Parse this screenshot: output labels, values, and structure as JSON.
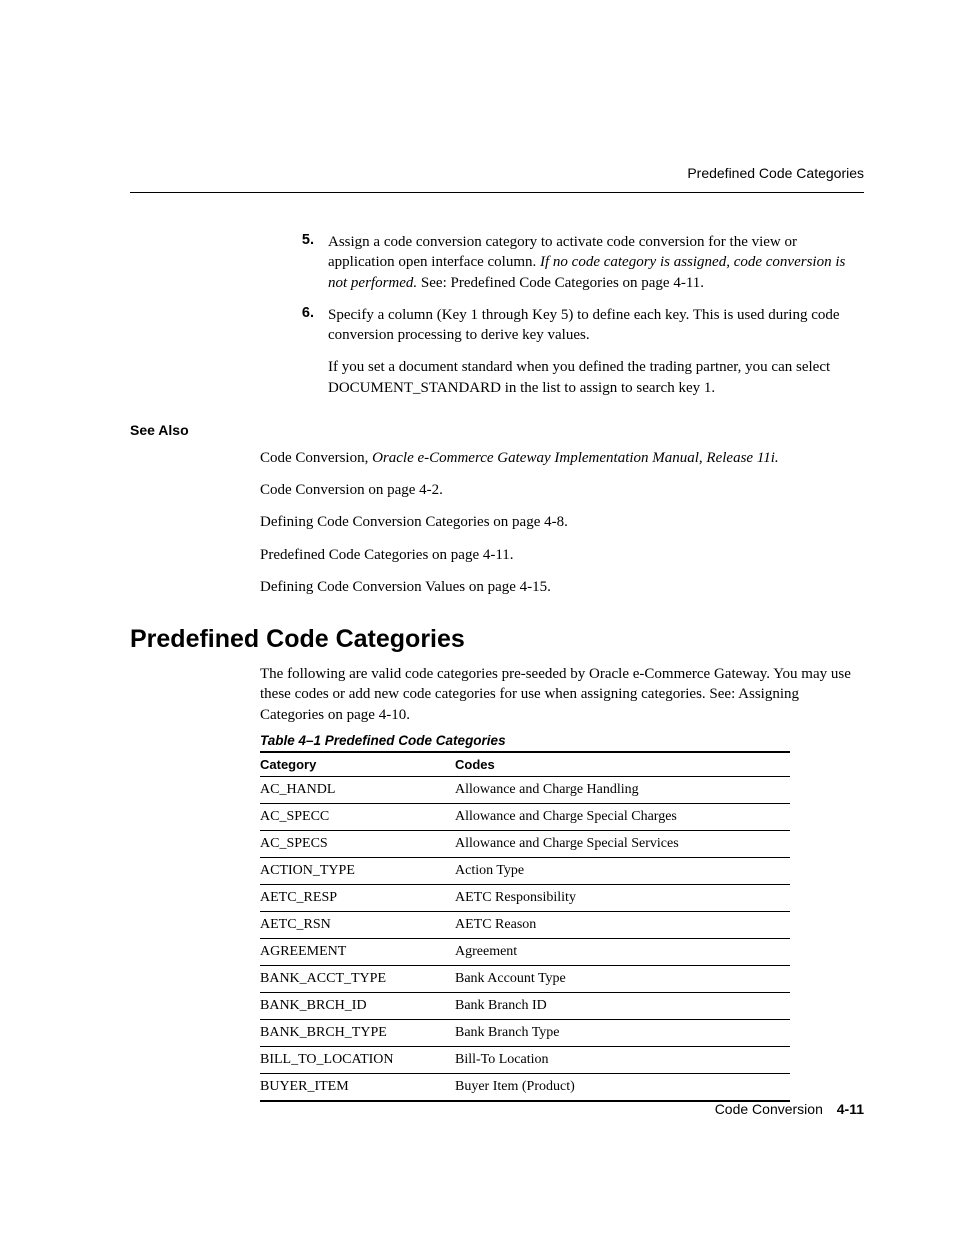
{
  "running_header": "Predefined Code Categories",
  "steps": {
    "step5": {
      "num": "5.",
      "text_a": "Assign a code conversion category to activate code conversion for the view or application open interface column.  ",
      "text_italic": "If no code category is assigned, code conversion is not performed.",
      "text_b": "  See: Predefined Code Categories on page 4-11."
    },
    "step6": {
      "num": "6.",
      "text": "Specify a column (Key 1 through Key 5) to define each key. This is used during code conversion processing to derive key values.",
      "extra": "If you set a document standard when you defined the trading partner, you can select DOCUMENT_STANDARD in the list to assign to search key 1."
    }
  },
  "see_also": {
    "heading": "See Also",
    "lines": [
      {
        "prefix": "Code Conversion, ",
        "italic": "Oracle e-Commerce Gateway Implementation Manual, Release 11i."
      },
      {
        "prefix": "Code Conversion on page 4-2."
      },
      {
        "prefix": "Defining Code Conversion Categories on page 4-8."
      },
      {
        "prefix": "Predefined Code Categories on page 4-11."
      },
      {
        "prefix": "Defining Code Conversion Values on page 4-15."
      }
    ]
  },
  "section": {
    "heading": "Predefined Code Categories",
    "intro": "The following are valid code categories pre-seeded by Oracle e-Commerce Gateway. You may use these codes or add new code categories for use when assigning categories.  See: Assigning Categories on page 4-10.",
    "table_caption": "Table 4–1   Predefined Code Categories",
    "columns": {
      "cat": "Category",
      "codes": "Codes"
    },
    "rows": [
      {
        "cat": "AC_HANDL",
        "codes": "Allowance and Charge Handling"
      },
      {
        "cat": "AC_SPECC",
        "codes": "Allowance and Charge Special Charges"
      },
      {
        "cat": "AC_SPECS",
        "codes": "Allowance and Charge Special Services"
      },
      {
        "cat": "ACTION_TYPE",
        "codes": "Action Type"
      },
      {
        "cat": "AETC_RESP",
        "codes": "AETC Responsibility"
      },
      {
        "cat": "AETC_RSN",
        "codes": "AETC Reason"
      },
      {
        "cat": "AGREEMENT",
        "codes": "Agreement"
      },
      {
        "cat": "BANK_ACCT_TYPE",
        "codes": "Bank Account Type"
      },
      {
        "cat": "BANK_BRCH_ID",
        "codes": "Bank Branch ID"
      },
      {
        "cat": "BANK_BRCH_TYPE",
        "codes": "Bank Branch Type"
      },
      {
        "cat": "BILL_TO_LOCATION",
        "codes": "Bill-To Location"
      },
      {
        "cat": "BUYER_ITEM",
        "codes": "Buyer Item (Product)"
      }
    ]
  },
  "footer": {
    "chapter": "Code Conversion",
    "page": "4-11"
  }
}
